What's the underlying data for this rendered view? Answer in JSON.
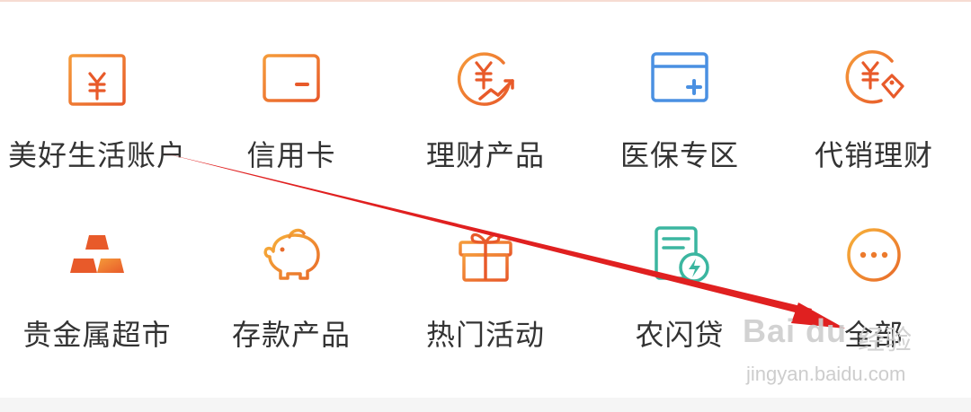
{
  "colors": {
    "accent": "#e85a2a",
    "accent_light": "#f59b3a",
    "blue": "#4a90e2",
    "teal": "#3bb6a0",
    "text": "#333333",
    "arrow": "#e02020"
  },
  "grid": {
    "items": [
      {
        "label": "美好生活账户",
        "icon": "calendar-yen-icon"
      },
      {
        "label": "信用卡",
        "icon": "credit-card-icon"
      },
      {
        "label": "理财产品",
        "icon": "yen-growth-icon"
      },
      {
        "label": "医保专区",
        "icon": "medical-card-icon"
      },
      {
        "label": "代销理财",
        "icon": "yen-tag-icon"
      },
      {
        "label": "贵金属超市",
        "icon": "gold-bars-icon"
      },
      {
        "label": "存款产品",
        "icon": "piggy-bank-icon"
      },
      {
        "label": "热门活动",
        "icon": "gift-icon"
      },
      {
        "label": "农闪贷",
        "icon": "document-flash-icon"
      },
      {
        "label": "全部",
        "icon": "more-icon"
      }
    ]
  },
  "watermark": {
    "brand": "Bai du",
    "cn": "经验",
    "url": "jingyan.baidu.com"
  }
}
